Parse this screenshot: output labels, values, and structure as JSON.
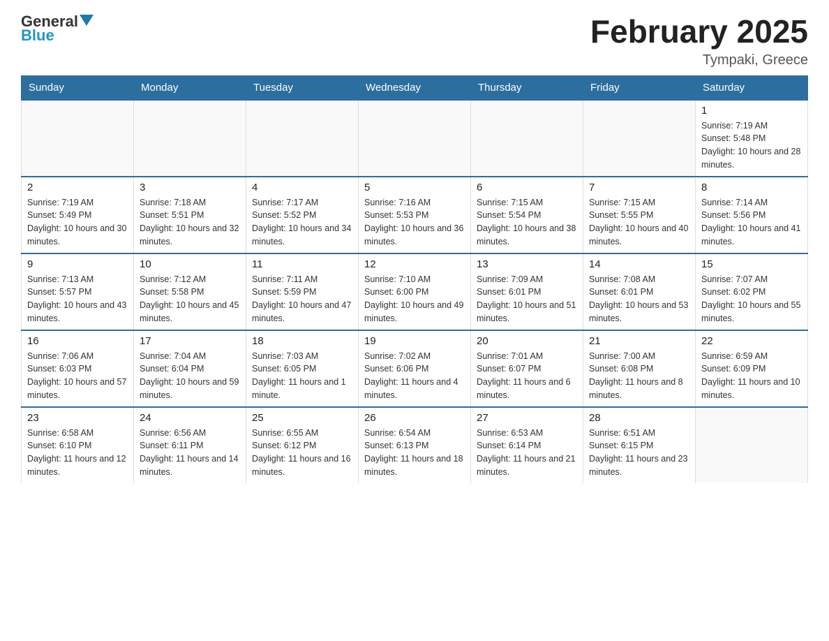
{
  "header": {
    "logo": {
      "general": "General",
      "arrow": "",
      "blue": "Blue"
    },
    "title": "February 2025",
    "location": "Tympaki, Greece"
  },
  "days_of_week": [
    "Sunday",
    "Monday",
    "Tuesday",
    "Wednesday",
    "Thursday",
    "Friday",
    "Saturday"
  ],
  "weeks": [
    [
      {
        "day": "",
        "info": ""
      },
      {
        "day": "",
        "info": ""
      },
      {
        "day": "",
        "info": ""
      },
      {
        "day": "",
        "info": ""
      },
      {
        "day": "",
        "info": ""
      },
      {
        "day": "",
        "info": ""
      },
      {
        "day": "1",
        "info": "Sunrise: 7:19 AM\nSunset: 5:48 PM\nDaylight: 10 hours and 28 minutes."
      }
    ],
    [
      {
        "day": "2",
        "info": "Sunrise: 7:19 AM\nSunset: 5:49 PM\nDaylight: 10 hours and 30 minutes."
      },
      {
        "day": "3",
        "info": "Sunrise: 7:18 AM\nSunset: 5:51 PM\nDaylight: 10 hours and 32 minutes."
      },
      {
        "day": "4",
        "info": "Sunrise: 7:17 AM\nSunset: 5:52 PM\nDaylight: 10 hours and 34 minutes."
      },
      {
        "day": "5",
        "info": "Sunrise: 7:16 AM\nSunset: 5:53 PM\nDaylight: 10 hours and 36 minutes."
      },
      {
        "day": "6",
        "info": "Sunrise: 7:15 AM\nSunset: 5:54 PM\nDaylight: 10 hours and 38 minutes."
      },
      {
        "day": "7",
        "info": "Sunrise: 7:15 AM\nSunset: 5:55 PM\nDaylight: 10 hours and 40 minutes."
      },
      {
        "day": "8",
        "info": "Sunrise: 7:14 AM\nSunset: 5:56 PM\nDaylight: 10 hours and 41 minutes."
      }
    ],
    [
      {
        "day": "9",
        "info": "Sunrise: 7:13 AM\nSunset: 5:57 PM\nDaylight: 10 hours and 43 minutes."
      },
      {
        "day": "10",
        "info": "Sunrise: 7:12 AM\nSunset: 5:58 PM\nDaylight: 10 hours and 45 minutes."
      },
      {
        "day": "11",
        "info": "Sunrise: 7:11 AM\nSunset: 5:59 PM\nDaylight: 10 hours and 47 minutes."
      },
      {
        "day": "12",
        "info": "Sunrise: 7:10 AM\nSunset: 6:00 PM\nDaylight: 10 hours and 49 minutes."
      },
      {
        "day": "13",
        "info": "Sunrise: 7:09 AM\nSunset: 6:01 PM\nDaylight: 10 hours and 51 minutes."
      },
      {
        "day": "14",
        "info": "Sunrise: 7:08 AM\nSunset: 6:01 PM\nDaylight: 10 hours and 53 minutes."
      },
      {
        "day": "15",
        "info": "Sunrise: 7:07 AM\nSunset: 6:02 PM\nDaylight: 10 hours and 55 minutes."
      }
    ],
    [
      {
        "day": "16",
        "info": "Sunrise: 7:06 AM\nSunset: 6:03 PM\nDaylight: 10 hours and 57 minutes."
      },
      {
        "day": "17",
        "info": "Sunrise: 7:04 AM\nSunset: 6:04 PM\nDaylight: 10 hours and 59 minutes."
      },
      {
        "day": "18",
        "info": "Sunrise: 7:03 AM\nSunset: 6:05 PM\nDaylight: 11 hours and 1 minute."
      },
      {
        "day": "19",
        "info": "Sunrise: 7:02 AM\nSunset: 6:06 PM\nDaylight: 11 hours and 4 minutes."
      },
      {
        "day": "20",
        "info": "Sunrise: 7:01 AM\nSunset: 6:07 PM\nDaylight: 11 hours and 6 minutes."
      },
      {
        "day": "21",
        "info": "Sunrise: 7:00 AM\nSunset: 6:08 PM\nDaylight: 11 hours and 8 minutes."
      },
      {
        "day": "22",
        "info": "Sunrise: 6:59 AM\nSunset: 6:09 PM\nDaylight: 11 hours and 10 minutes."
      }
    ],
    [
      {
        "day": "23",
        "info": "Sunrise: 6:58 AM\nSunset: 6:10 PM\nDaylight: 11 hours and 12 minutes."
      },
      {
        "day": "24",
        "info": "Sunrise: 6:56 AM\nSunset: 6:11 PM\nDaylight: 11 hours and 14 minutes."
      },
      {
        "day": "25",
        "info": "Sunrise: 6:55 AM\nSunset: 6:12 PM\nDaylight: 11 hours and 16 minutes."
      },
      {
        "day": "26",
        "info": "Sunrise: 6:54 AM\nSunset: 6:13 PM\nDaylight: 11 hours and 18 minutes."
      },
      {
        "day": "27",
        "info": "Sunrise: 6:53 AM\nSunset: 6:14 PM\nDaylight: 11 hours and 21 minutes."
      },
      {
        "day": "28",
        "info": "Sunrise: 6:51 AM\nSunset: 6:15 PM\nDaylight: 11 hours and 23 minutes."
      },
      {
        "day": "",
        "info": ""
      }
    ]
  ]
}
